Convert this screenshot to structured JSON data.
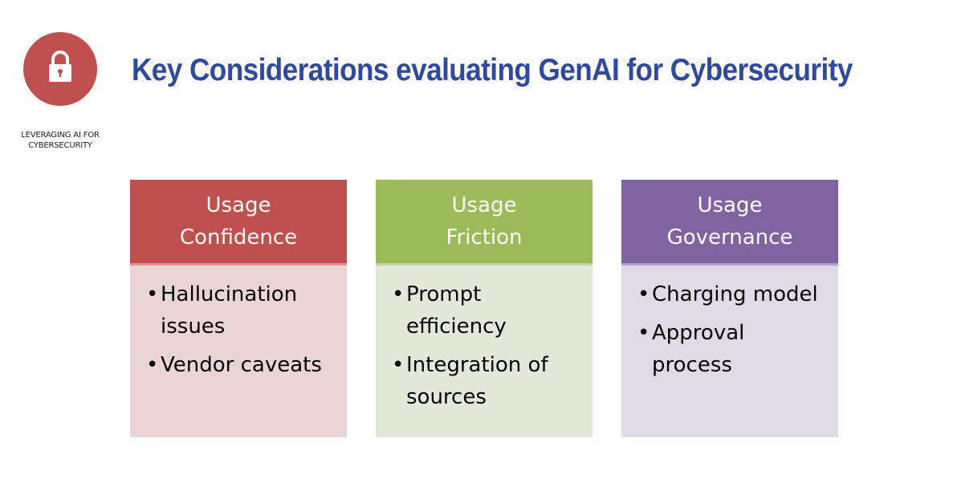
{
  "logo": {
    "icon": "lock-icon",
    "caption_line1": "LEVERAGING AI FOR",
    "caption_line2": "CYBERSECURITY"
  },
  "title": "Key Considerations evaluating GenAI for Cybersecurity",
  "colors": {
    "title": "#2e4aa0",
    "red": "#c0504d",
    "green": "#9bbb59",
    "purple": "#8064a2"
  },
  "cards": [
    {
      "header_line1": "Usage",
      "header_line2": "Confidence",
      "header_color": "#c0504d",
      "body_color": "#ead5d5",
      "items": [
        "Hallucination issues",
        "Vendor caveats"
      ]
    },
    {
      "header_line1": "Usage",
      "header_line2": "Friction",
      "header_color": "#9bbb59",
      "body_color": "#e3e9d9",
      "items": [
        "Prompt efficiency",
        "Integration of sources"
      ]
    },
    {
      "header_line1": "Usage",
      "header_line2": "Governance",
      "header_color": "#8064a2",
      "body_color": "#dfdbe6",
      "items": [
        "Charging model",
        "Approval process"
      ]
    }
  ]
}
